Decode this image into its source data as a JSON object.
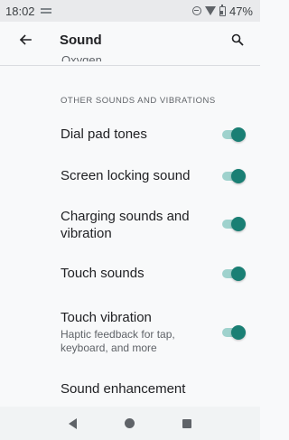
{
  "status_bar": {
    "time": "18:02",
    "battery": "47%"
  },
  "app_bar": {
    "title": "Sound"
  },
  "clipped_item": "Oxygen",
  "section_header": "OTHER SOUNDS AND VIBRATIONS",
  "settings": [
    {
      "title": "Dial pad tones",
      "enabled": true
    },
    {
      "title": "Screen locking sound",
      "enabled": true
    },
    {
      "title_line1": "Charging sounds and",
      "title_line2": "vibration",
      "enabled": true
    },
    {
      "title": "Touch sounds",
      "enabled": true
    },
    {
      "title": "Touch vibration",
      "subtitle_line1": "Haptic feedback for tap,",
      "subtitle_line2": "keyboard, and more",
      "enabled": true
    },
    {
      "title": "Sound enhancement"
    }
  ],
  "colors": {
    "toggle_thumb": "#1a7f74",
    "toggle_track": "#9fd2cd",
    "background": "#f8f9fa"
  }
}
